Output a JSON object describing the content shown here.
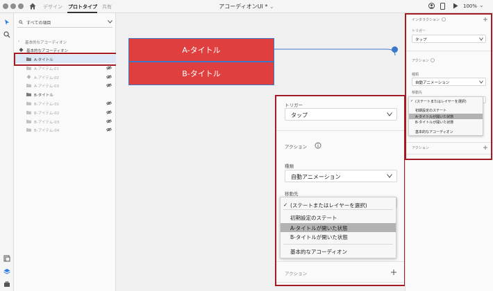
{
  "topbar": {
    "tabs": [
      "デザイン",
      "プロトタイプ",
      "共有"
    ],
    "active_tab": 1,
    "doc_title": "アコーディオンUI *",
    "zoom": "100%"
  },
  "layers": {
    "search_label": "すべての項目",
    "back_label": "基本的なアコーディオン",
    "group_label": "基本的なアコーディオン",
    "items": [
      {
        "label": "A-タイトル",
        "kind": "folder",
        "dim": false,
        "eye": false,
        "selected": true
      },
      {
        "label": "A-アイテム-01",
        "kind": "sub",
        "dim": true,
        "eye": true,
        "selected": false
      },
      {
        "label": "A-アイテム-02",
        "kind": "component",
        "dim": true,
        "eye": true,
        "selected": false
      },
      {
        "label": "A-アイテム-03",
        "kind": "sub",
        "dim": true,
        "eye": true,
        "selected": false
      },
      {
        "label": "B-タイトル",
        "kind": "folder",
        "dim": false,
        "eye": false,
        "selected": false
      },
      {
        "label": "B-アイテム-01",
        "kind": "sub",
        "dim": true,
        "eye": true,
        "selected": false
      },
      {
        "label": "B-アイテム-02",
        "kind": "sub",
        "dim": true,
        "eye": true,
        "selected": false
      },
      {
        "label": "B-アイテム-03",
        "kind": "sub",
        "dim": true,
        "eye": true,
        "selected": false
      },
      {
        "label": "B-アイテム-04",
        "kind": "sub",
        "dim": true,
        "eye": true,
        "selected": false
      }
    ]
  },
  "canvas": {
    "button_a": "A-タイトル",
    "button_b": "B-タイトル"
  },
  "zoom_panel": {
    "trigger_label": "トリガー",
    "trigger_value": "タップ",
    "action_label": "アクション",
    "type_label": "種類",
    "type_value": "自動アニメーション",
    "dest_label": "移動先",
    "menu_items": [
      {
        "label": "(ステートまたはレイヤーを選択)",
        "checked": true,
        "highlighted": false
      },
      {
        "label": "初期設定のステート",
        "checked": false,
        "highlighted": false
      },
      {
        "label": "A-タイトルが開いた状態",
        "checked": false,
        "highlighted": true
      },
      {
        "label": "B-タイトルが開いた状態",
        "checked": false,
        "highlighted": false
      },
      {
        "label": "基本的なアコーディオン",
        "checked": false,
        "highlighted": false
      }
    ],
    "action_add_label": "アクション"
  },
  "inspector": {
    "interaction_label": "インタラクション",
    "trigger_label": "トリガー",
    "trigger_value": "タップ",
    "action_label": "アクション",
    "type_label": "種類",
    "type_value": "自動アニメーション",
    "dest_label": "移動先",
    "action_add_label": "アクション"
  },
  "colors": {
    "button_red": "#df3f3f",
    "accent_blue": "#3c78c9",
    "highlight_box": "#a31a22"
  }
}
